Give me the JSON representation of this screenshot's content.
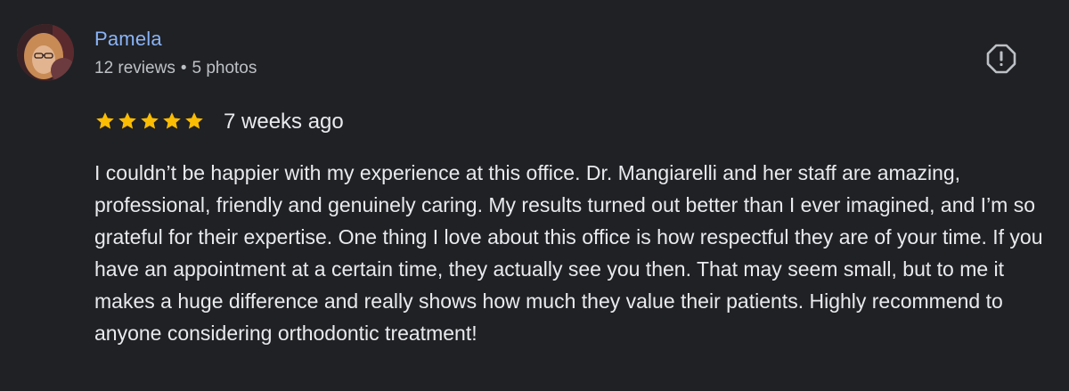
{
  "review": {
    "author": {
      "name": "Pamela",
      "reviews_count": "12 reviews",
      "separator": "•",
      "photos_count": "5 photos"
    },
    "rating": 5,
    "date": "7 weeks ago",
    "text": "I couldn’t be happier with my experience at this office. Dr. Mangiarelli and her staff are amazing, professional, friendly and genuinely caring. My results turned out better than I ever imagined, and I’m so grateful for their expertise. One thing I love about this office is how respectful they are of your time. If you have an appointment at a certain time, they actually see you then. That may seem small, but to me it makes a huge difference and really shows how much they value their patients. Highly recommend to anyone considering orthodontic treatment!"
  },
  "icons": {
    "report": "report-flag-icon",
    "star": "star-icon"
  },
  "colors": {
    "background": "#202124",
    "author_name": "#8ab4f8",
    "meta_text": "#bdc1c6",
    "body_text": "#e8eaed",
    "star": "#fbbc04",
    "icon": "#bdc1c6"
  }
}
